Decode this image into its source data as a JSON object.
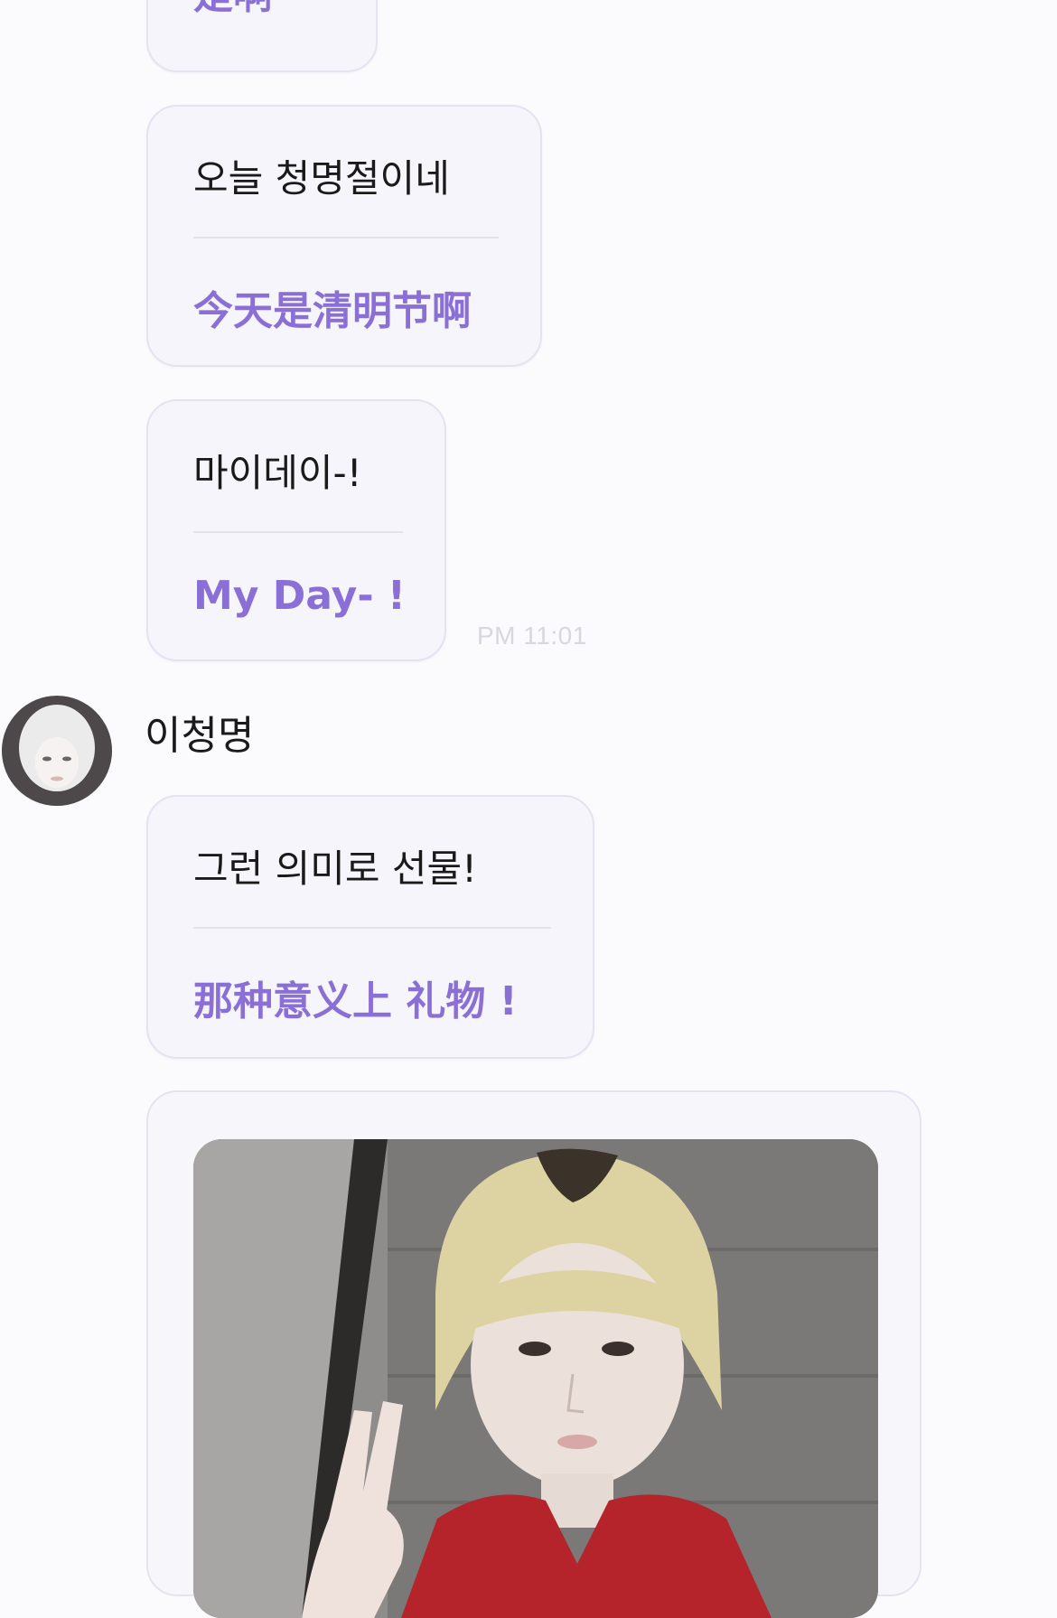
{
  "messages": [
    {
      "original": "",
      "translation": "是啊~"
    },
    {
      "original": "오늘 청명절이네",
      "translation": "今天是清明节啊"
    },
    {
      "original": "마이데이-!",
      "translation": "My Day- !",
      "time": "PM 11:01"
    },
    {
      "original": "그런 의미로 선물!",
      "translation": "那种意义上 礼物 !"
    }
  ],
  "sender": {
    "name": "이청명"
  },
  "icons": {
    "avatar": "profile-avatar",
    "photo": "shared-photo"
  },
  "colors": {
    "translation_text": "#8a6fd6",
    "bubble_bg": "#f5f5fb",
    "bubble_border": "#e4e3f0",
    "timestamp": "#d7d7de"
  }
}
